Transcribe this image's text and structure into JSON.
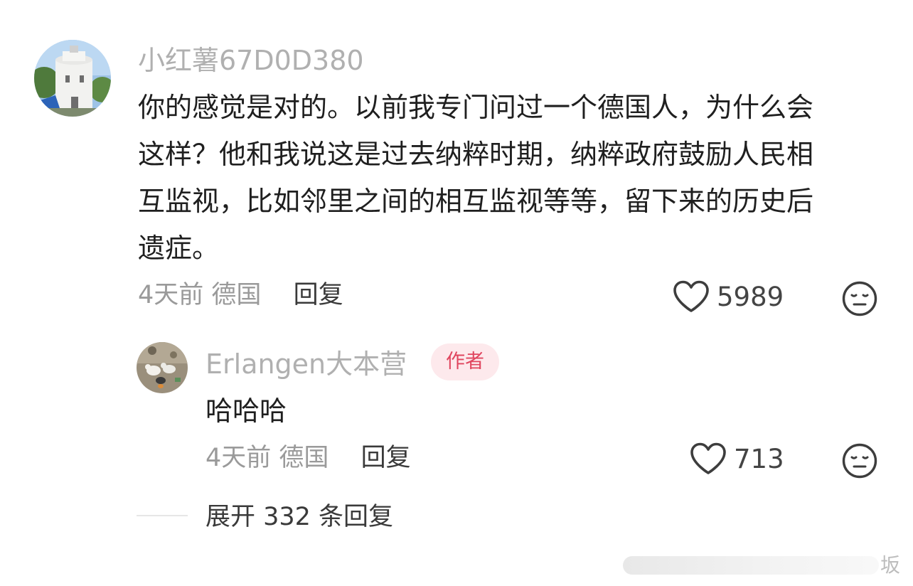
{
  "main_comment": {
    "username": "小红薯67D0D380",
    "text_lines": [
      "你的感觉是对的。以前我专门问过一个德国人，为什么会",
      "这样？他和我说这是过去纳粹时期，纳粹政府鼓励人民相",
      "互监视，比如邻里之间的相互监视等等，留下来的历史后",
      "遗症。"
    ],
    "time": "4天前",
    "location": "德国",
    "reply_label": "回复",
    "likes": "5989",
    "like_icon": "heart-outline-icon",
    "dislike_icon": "neutral-face-icon"
  },
  "reply_comment": {
    "username": "Erlangen大本营",
    "badge": "作者",
    "text": "哈哈哈",
    "time": "4天前",
    "location": "德国",
    "reply_label": "回复",
    "likes": "713"
  },
  "expand": {
    "label": "展开 332 条回复"
  },
  "watermark": {
    "char": "坂"
  },
  "colors": {
    "username": "#b0b0b0",
    "badge_bg": "#fde9ec",
    "badge_text": "#e0455e",
    "meta": "#9a9a9a",
    "body_text": "#1f1f1f"
  }
}
